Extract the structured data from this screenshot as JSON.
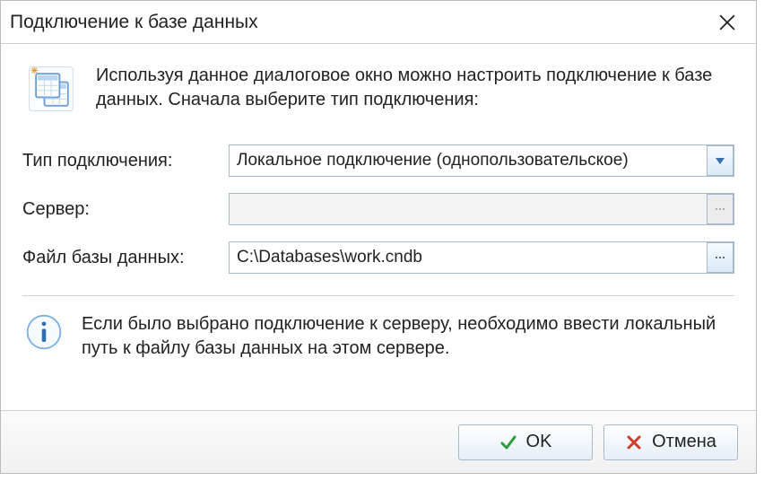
{
  "title": "Подключение к базе данных",
  "intro": "Используя данное диалоговое окно можно настроить подключение к базе данных. Сначала выберите тип подключения:",
  "form": {
    "conn_type_label": "Тип подключения:",
    "conn_type_value": "Локальное подключение (однопользовательское)",
    "server_label": "Сервер:",
    "server_value": "",
    "db_file_label": "Файл базы данных:",
    "db_file_value": "C:\\Databases\\work.cndb"
  },
  "info": "Если было выбрано подключение к серверу, необходимо ввести локальный путь к файлу базы данных на этом сервере.",
  "buttons": {
    "ok": "OK",
    "cancel": "Отмена"
  }
}
